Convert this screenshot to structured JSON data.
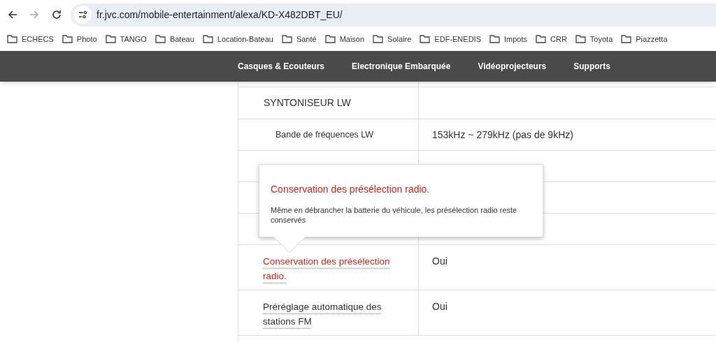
{
  "browser": {
    "url": "fr.jvc.com/mobile-entertainment/alexa/KD-X482DBT_EU/",
    "bookmarks": [
      "ECHECS",
      "Photo",
      "TANGO",
      "Bateau",
      "Location-Bateau",
      "Santé",
      "Maison",
      "Solaire",
      "EDF-ENEDIS",
      "Impots",
      "CRR",
      "Toyota",
      "Piazzetta"
    ]
  },
  "nav": {
    "items": [
      "Casques & Ecouteurs",
      "Electronique Embarquée",
      "Vidéoprojecteurs",
      "Supports"
    ]
  },
  "spec_table": {
    "rows": [
      {
        "kind": "section",
        "label": "SYNTONISEUR LW"
      },
      {
        "kind": "sub",
        "label": "Bande de fréquences LW",
        "value": "153kHz ~ 279kHz (pas de 9kHz)"
      },
      {
        "kind": "blank"
      },
      {
        "kind": "blank"
      },
      {
        "kind": "blank"
      },
      {
        "kind": "term",
        "label": "Conservation des présélection radio.",
        "value": "Oui",
        "active": true
      },
      {
        "kind": "term",
        "label": "Préréglage automatique des stations FM",
        "value": "Oui",
        "active": false
      }
    ]
  },
  "tooltip": {
    "title": "Conservation des présélection radio.",
    "body": "Même en débrancher la batterie du véhicule, les présélection radio reste conservés"
  }
}
